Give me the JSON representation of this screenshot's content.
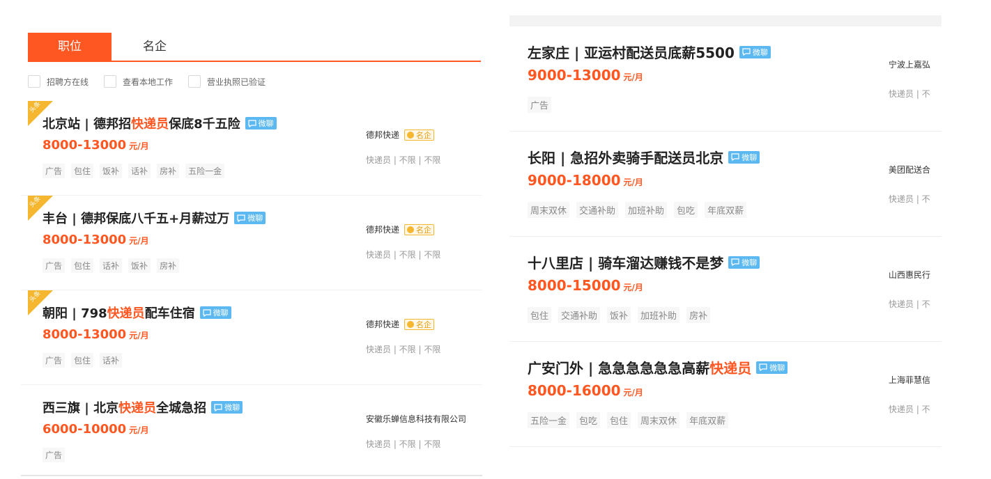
{
  "tabs": [
    {
      "label": "职位",
      "active": true
    },
    {
      "label": "名企",
      "active": false
    }
  ],
  "filters": [
    "招聘方在线",
    "查看本地工作",
    "营业执照已验证"
  ],
  "chat_badge": "微聊",
  "ribbon_label": "头条",
  "famous_label": "名企",
  "colors": {
    "accent": "#ff5722",
    "chat": "#5bb8f0",
    "ribbon": "#f5b730"
  },
  "left_jobs": [
    {
      "ribbon": true,
      "title_parts": [
        "北京站 | 德邦招",
        "快递员",
        "保底8千五险"
      ],
      "salary": "8000-13000",
      "unit": "元/月",
      "tags": [
        "广告",
        "包住",
        "饭补",
        "话补",
        "房补",
        "五险一金"
      ],
      "company": "德邦快递",
      "famous": true,
      "meta": "快递员 | 不限 | 不限"
    },
    {
      "ribbon": true,
      "title_parts": [
        "丰台 | 德邦保底八千五+月薪过万",
        "",
        ""
      ],
      "salary": "8000-13000",
      "unit": "元/月",
      "tags": [
        "广告",
        "包住",
        "话补",
        "饭补",
        "房补"
      ],
      "company": "德邦快递",
      "famous": true,
      "meta": "快递员 | 不限 | 不限"
    },
    {
      "ribbon": true,
      "title_parts": [
        "朝阳 | 798",
        "快递员",
        "配车住宿"
      ],
      "salary": "8000-13000",
      "unit": "元/月",
      "tags": [
        "广告",
        "包住",
        "话补"
      ],
      "company": "德邦快递",
      "famous": true,
      "meta": "快递员 | 不限 | 不限"
    },
    {
      "ribbon": false,
      "title_parts": [
        "西三旗 | 北京",
        "快递员",
        "全城急招"
      ],
      "salary": "6000-10000",
      "unit": "元/月",
      "tags": [
        "广告"
      ],
      "company": "安徽乐蝉信息科技有限公司",
      "famous": false,
      "meta": "快递员 | 不限 | 不限"
    }
  ],
  "right_jobs": [
    {
      "title_parts": [
        "左家庄 | 亚运村配送员底薪5500",
        "",
        ""
      ],
      "salary": "9000-13000",
      "unit": "元/月",
      "tags": [
        "广告"
      ],
      "company": "宁波上嘉弘",
      "meta": "快递员 | 不"
    },
    {
      "title_parts": [
        "长阳 | 急招外卖骑手配送员北京",
        "",
        ""
      ],
      "salary": "9000-18000",
      "unit": "元/月",
      "tags": [
        "周末双休",
        "交通补助",
        "加班补助",
        "包吃",
        "年底双薪"
      ],
      "company": "美团配送合",
      "meta": "快递员 | 不"
    },
    {
      "title_parts": [
        "十八里店 | 骑车溜达赚钱不是梦",
        "",
        ""
      ],
      "salary": "8000-15000",
      "unit": "元/月",
      "tags": [
        "包住",
        "交通补助",
        "饭补",
        "加班补助",
        "房补"
      ],
      "company": "山西惠民行",
      "meta": "快递员 | 不"
    },
    {
      "title_parts": [
        "广安门外 | 急急急急急急高薪",
        "快递员",
        ""
      ],
      "salary": "8000-16000",
      "unit": "元/月",
      "tags": [
        "五险一金",
        "包吃",
        "包住",
        "周末双休",
        "年底双薪"
      ],
      "company": "上海菲慧信",
      "meta": "快递员 | 不"
    }
  ]
}
